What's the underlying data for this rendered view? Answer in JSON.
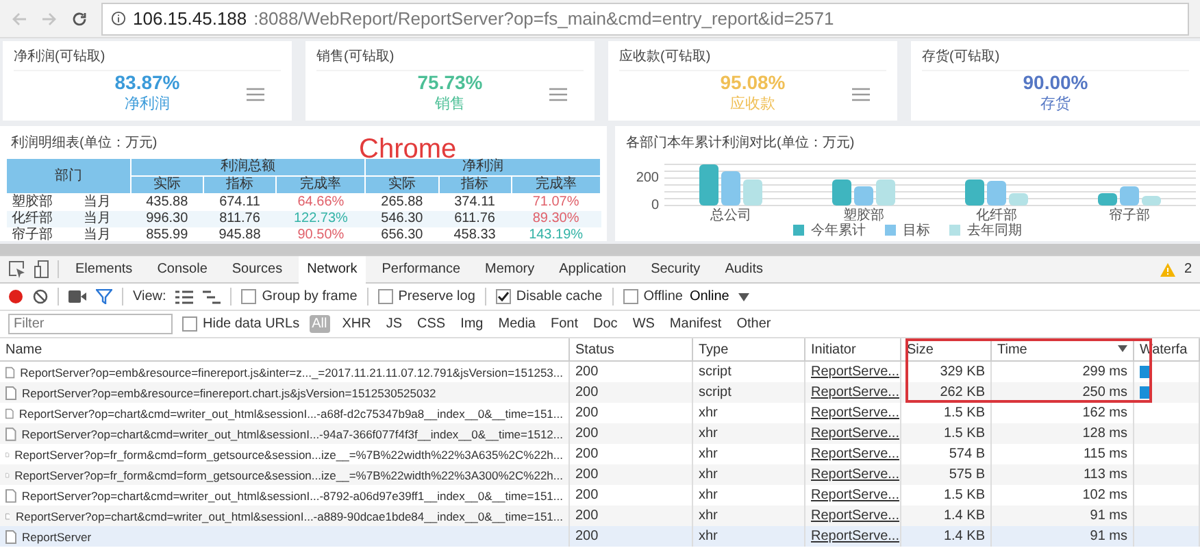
{
  "browser": {
    "url_host": "106.15.45.188",
    "url_path": ":8088/WebReport/ReportServer?op=fs_main&cmd=entry_report&id=2571"
  },
  "kpi_cards": [
    {
      "title": "净利润(可钻取)",
      "value": "83.87%",
      "label": "净利润",
      "color": "#3a9ad9",
      "menu": true
    },
    {
      "title": "销售(可钻取)",
      "value": "75.73%",
      "label": "销售",
      "color": "#4cbf96",
      "menu": true
    },
    {
      "title": "应收款(可钻取)",
      "value": "95.08%",
      "label": "应收款",
      "color": "#f0bf55",
      "menu": true
    },
    {
      "title": "存货(可钻取)",
      "value": "90.00%",
      "label": "存货",
      "color": "#5577c4",
      "menu": false
    }
  ],
  "profit_table": {
    "title": "利润明细表(单位：万元)",
    "dept_header": "部门",
    "groups": [
      "利润总额",
      "净利润"
    ],
    "subheaders": [
      "实际",
      "指标",
      "完成率",
      "实际",
      "指标",
      "完成率"
    ],
    "rows": [
      {
        "dept": "塑胶部",
        "period": "当月",
        "cells": [
          {
            "text": "435.88"
          },
          {
            "text": "674.11"
          },
          {
            "text": "64.66%",
            "color": "#e0606a"
          },
          {
            "text": "265.88"
          },
          {
            "text": "374.11"
          },
          {
            "text": "71.07%",
            "color": "#e0606a"
          }
        ]
      },
      {
        "dept": "化纤部",
        "period": "当月",
        "cells": [
          {
            "text": "996.30"
          },
          {
            "text": "811.76"
          },
          {
            "text": "122.73%",
            "color": "#33b3a6"
          },
          {
            "text": "546.30"
          },
          {
            "text": "611.76"
          },
          {
            "text": "89.30%",
            "color": "#e0606a"
          }
        ]
      },
      {
        "dept": "帘子部",
        "period": "当月",
        "cells": [
          {
            "text": "855.99"
          },
          {
            "text": "945.88"
          },
          {
            "text": "90.50%",
            "color": "#e0606a"
          },
          {
            "text": "656.30"
          },
          {
            "text": "458.33"
          },
          {
            "text": "143.19%",
            "color": "#33b3a6"
          }
        ]
      }
    ]
  },
  "overlay_label": "Chrome",
  "chart_panel": {
    "title": "各部门本年累计利润对比(单位：万元)",
    "chart_data": {
      "type": "bar",
      "categories": [
        "总公司",
        "塑胶部",
        "化纤部",
        "帘子部"
      ],
      "yticks": [
        0,
        200
      ],
      "ylim": [
        0,
        300
      ],
      "legend": true,
      "series": [
        {
          "name": "今年累计",
          "color": "#3fb5bf",
          "values": [
            300,
            190,
            190,
            90
          ]
        },
        {
          "name": "目标",
          "color": "#84c6ec",
          "values": [
            250,
            140,
            180,
            140
          ]
        },
        {
          "name": "去年同期",
          "color": "#b4e2e6",
          "values": [
            190,
            190,
            90,
            70
          ]
        }
      ]
    }
  },
  "devtools": {
    "tabs": [
      {
        "label": "Elements",
        "selected": false
      },
      {
        "label": "Console",
        "selected": false
      },
      {
        "label": "Sources",
        "selected": false
      },
      {
        "label": "Network",
        "selected": true
      },
      {
        "label": "Performance",
        "selected": false
      },
      {
        "label": "Memory",
        "selected": false
      },
      {
        "label": "Application",
        "selected": false
      },
      {
        "label": "Security",
        "selected": false
      },
      {
        "label": "Audits",
        "selected": false
      }
    ],
    "warnings": "2",
    "view_label": "View:",
    "checkboxes": [
      {
        "label": "Group by frame",
        "checked": false
      },
      {
        "label": "Preserve log",
        "checked": false
      },
      {
        "label": "Disable cache",
        "checked": true
      },
      {
        "label": "Offline",
        "checked": false
      }
    ],
    "throttle": "Online",
    "filter": {
      "placeholder": "Filter",
      "hide_data_urls": {
        "label": "Hide data URLs",
        "checked": false
      },
      "types": [
        {
          "label": "All",
          "selected": true
        },
        {
          "label": "XHR",
          "selected": false
        },
        {
          "label": "JS",
          "selected": false
        },
        {
          "label": "CSS",
          "selected": false
        },
        {
          "label": "Img",
          "selected": false
        },
        {
          "label": "Media",
          "selected": false
        },
        {
          "label": "Font",
          "selected": false
        },
        {
          "label": "Doc",
          "selected": false
        },
        {
          "label": "WS",
          "selected": false
        },
        {
          "label": "Manifest",
          "selected": false
        },
        {
          "label": "Other",
          "selected": false
        }
      ]
    },
    "columns": [
      {
        "label": "Name",
        "sorted": false
      },
      {
        "label": "Status",
        "sorted": false
      },
      {
        "label": "Type",
        "sorted": false
      },
      {
        "label": "Initiator",
        "sorted": false
      },
      {
        "label": "Size",
        "sorted": false
      },
      {
        "label": "Time",
        "sorted": true
      },
      {
        "label": "Waterfa",
        "sorted": false
      }
    ],
    "rows": [
      {
        "name": "ReportServer?op=emb&resource=finereport.js&inter=z..._=2017.11.21.11.07.12.791&jsVersion=151253...",
        "status": "200",
        "type": "script",
        "initiator": "ReportServe...",
        "size": "329 KB",
        "time": "299 ms",
        "waterfall": true,
        "selected": false
      },
      {
        "name": "ReportServer?op=emb&resource=finereport.chart.js&jsVersion=1512530525032",
        "status": "200",
        "type": "script",
        "initiator": "ReportServe...",
        "size": "262 KB",
        "time": "250 ms",
        "waterfall": true,
        "selected": false
      },
      {
        "name": "ReportServer?op=chart&cmd=writer_out_html&sessionI...-a68f-d2c75347b9a8__index__0&__time=151...",
        "status": "200",
        "type": "xhr",
        "initiator": "ReportServe...",
        "size": "1.5 KB",
        "time": "162 ms",
        "waterfall": false,
        "selected": false
      },
      {
        "name": "ReportServer?op=chart&cmd=writer_out_html&sessionI...-94a7-366f077f4f3f__index__0&__time=1512...",
        "status": "200",
        "type": "xhr",
        "initiator": "ReportServe...",
        "size": "1.5 KB",
        "time": "128 ms",
        "waterfall": false,
        "selected": false
      },
      {
        "name": "ReportServer?op=fr_form&cmd=form_getsource&session...ize__=%7B%22width%22%3A635%2C%22h...",
        "status": "200",
        "type": "xhr",
        "initiator": "ReportServe...",
        "size": "574 B",
        "time": "115 ms",
        "waterfall": false,
        "selected": false
      },
      {
        "name": "ReportServer?op=fr_form&cmd=form_getsource&session...ize__=%7B%22width%22%3A300%2C%22h...",
        "status": "200",
        "type": "xhr",
        "initiator": "ReportServe...",
        "size": "575 B",
        "time": "113 ms",
        "waterfall": false,
        "selected": false
      },
      {
        "name": "ReportServer?op=chart&cmd=writer_out_html&sessionI...-8792-a06d97e39ff1__index__0&__time=151...",
        "status": "200",
        "type": "xhr",
        "initiator": "ReportServe...",
        "size": "1.5 KB",
        "time": "102 ms",
        "waterfall": false,
        "selected": false
      },
      {
        "name": "ReportServer?op=chart&cmd=writer_out_html&sessionI...-a889-90dcae1bde84__index__0&__time=151...",
        "status": "200",
        "type": "xhr",
        "initiator": "ReportServe...",
        "size": "1.4 KB",
        "time": "91 ms",
        "waterfall": false,
        "selected": false
      },
      {
        "name": "ReportServer",
        "status": "200",
        "type": "xhr",
        "initiator": "ReportServe...",
        "size": "1.4 KB",
        "time": "91 ms",
        "waterfall": false,
        "selected": true
      }
    ]
  }
}
